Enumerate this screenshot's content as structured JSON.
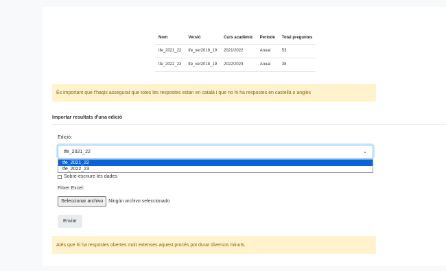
{
  "table": {
    "headers": [
      "Nom",
      "Versió",
      "Curs acadèmic",
      "Període",
      "Total preguntes"
    ],
    "rows": [
      [
        "tfe_2021_22",
        "tfe_ver2018_19",
        "2021/2022",
        "Anual",
        "53"
      ],
      [
        "tfe_2022_23",
        "tfe_ver2018_19",
        "2022/2023",
        "Anual",
        "38"
      ]
    ]
  },
  "alert_language": "És important que t'haqis assegurat que totes les respostes estan en català i que no hi ha respostes en castellà o anglès",
  "import_section": {
    "title": "Importar resultats d'una edició",
    "edition_label": "Edició:",
    "edition_selected": "tfe_2021_22",
    "edition_options": [
      "tfe_2021_22",
      "tfe_2022_23"
    ],
    "overwrite_label": "Sobre-escriure les dades",
    "file_label": "Fitxer Excel:",
    "file_button": "Seleccionar archivo",
    "file_status": "Ningún archivo seleccionado",
    "submit_label": "Enviar"
  },
  "alert_duration": "Atès que hi ha respostes obertes molt extenses aquest procés pot durar diversos minuts.",
  "colors": {
    "alert_bg": "#fff3cd",
    "alert_text": "#856404",
    "selected_option": "#0a64d6",
    "focus_border": "#80bdff"
  }
}
